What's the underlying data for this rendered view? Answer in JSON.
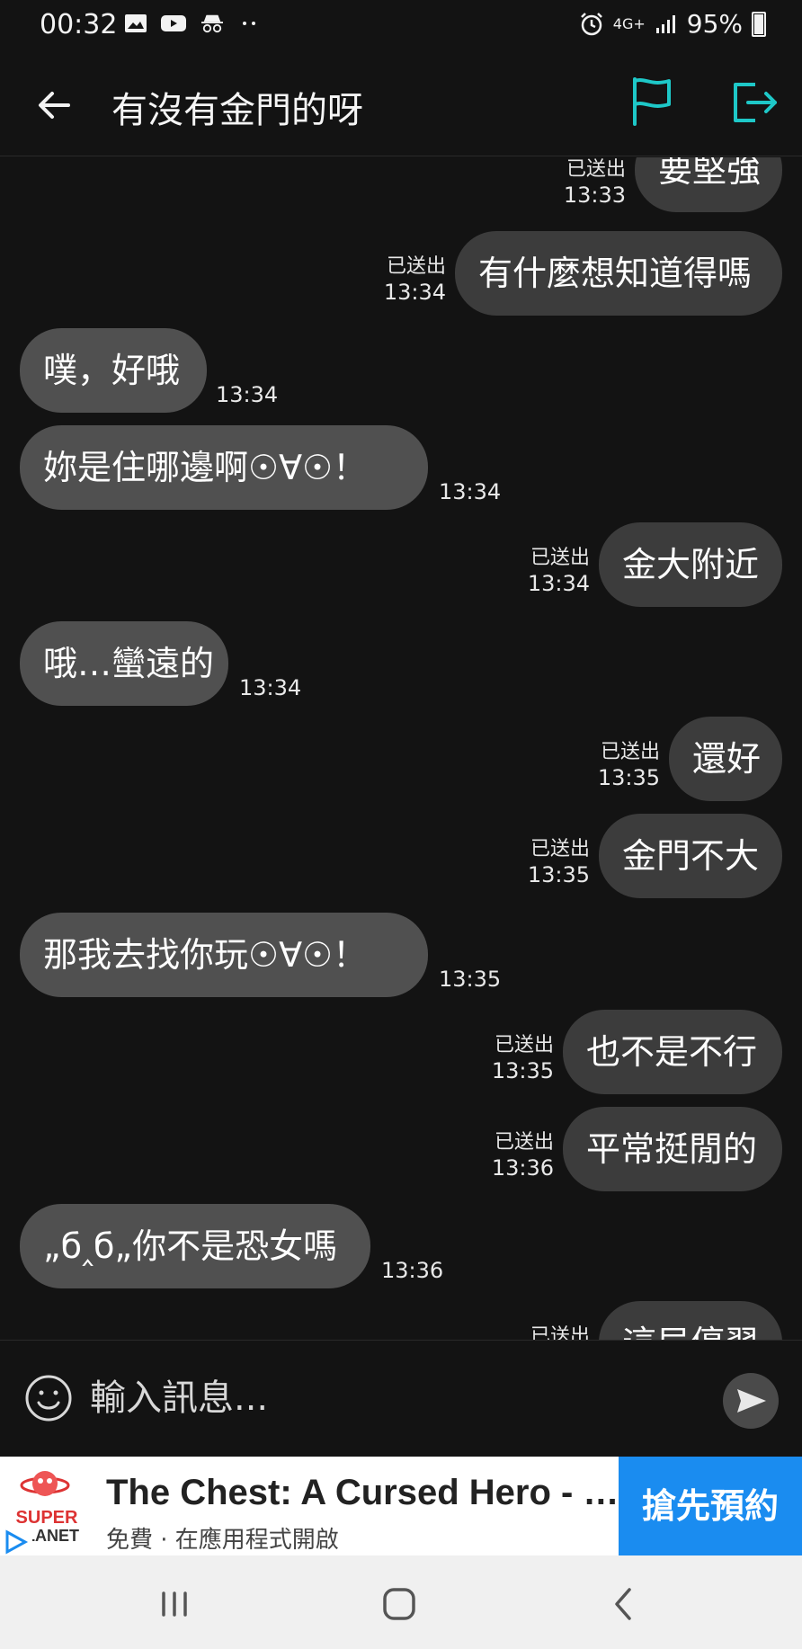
{
  "status_bar": {
    "time": "00:32",
    "network": "4G+",
    "battery": "95%"
  },
  "header": {
    "title": "有沒有金門的呀"
  },
  "messages": [
    {
      "side": "sent",
      "text": "要堅強",
      "status": "已送出",
      "time": "13:33"
    },
    {
      "side": "sent",
      "text": "有什麼想知道得嗎",
      "status": "已送出",
      "time": "13:34"
    },
    {
      "side": "received",
      "text": "噗，好哦",
      "time": "13:34"
    },
    {
      "side": "received",
      "text": "妳是住哪邊啊☉∀☉！",
      "time": "13:34"
    },
    {
      "side": "sent",
      "text": "金大附近",
      "status": "已送出",
      "time": "13:34"
    },
    {
      "side": "received",
      "text": "哦…蠻遠的",
      "time": "13:34"
    },
    {
      "side": "sent",
      "text": "還好",
      "status": "已送出",
      "time": "13:35"
    },
    {
      "side": "sent",
      "text": "金門不大",
      "status": "已送出",
      "time": "13:35"
    },
    {
      "side": "received",
      "text": "那我去找你玩☉∀☉！",
      "time": "13:35"
    },
    {
      "side": "sent",
      "text": "也不是不行",
      "status": "已送出",
      "time": "13:35"
    },
    {
      "side": "sent",
      "text": "平常挺閒的",
      "status": "已送出",
      "time": "13:36"
    },
    {
      "side": "received",
      "text": "„б‸б„你不是恐女嗎",
      "time": "13:36"
    },
    {
      "side": "sent",
      "text": "這局停習",
      "status": "已送出",
      "time": ""
    }
  ],
  "input": {
    "placeholder": "輸入訊息..."
  },
  "ad": {
    "logo_text": "SUPER PLANET",
    "title": "The Chest: A Cursed Hero - …",
    "subtitle": "免費 · 在應用程式開啟",
    "cta": "搶先預約"
  },
  "colors": {
    "background": "#131313",
    "received_bubble": "#505050",
    "sent_bubble": "#3c3c3c",
    "accent": "#1ec8c8",
    "ad_cta": "#1a8cf0"
  },
  "icons": {
    "back": "arrow-left-icon",
    "report": "flag-icon",
    "leave": "exit-icon",
    "emoji": "smiley-icon",
    "send": "send-icon"
  }
}
